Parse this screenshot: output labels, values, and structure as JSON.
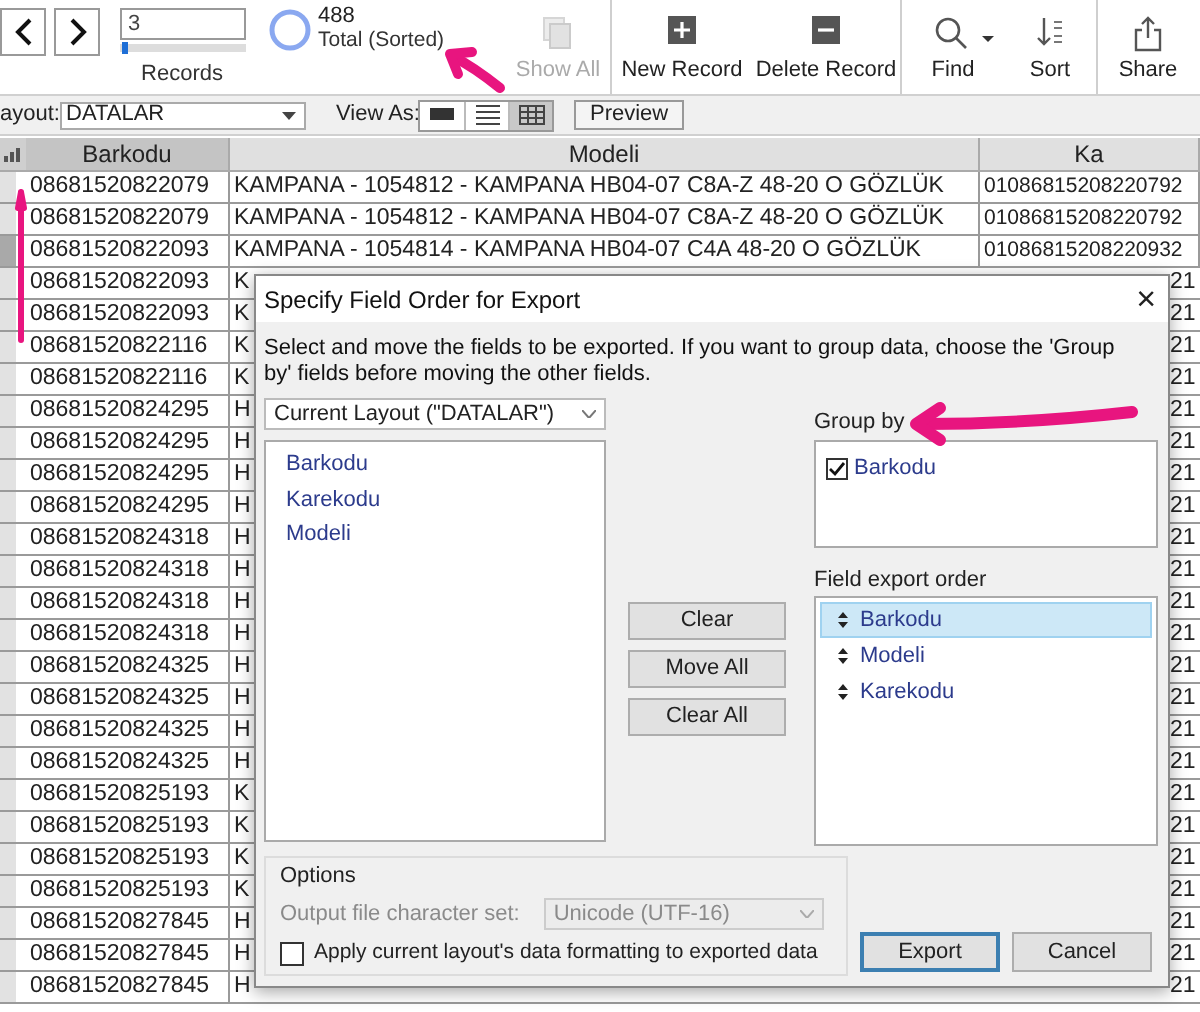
{
  "toolbar": {
    "record_number": "3",
    "record_slider": {
      "level": 0.01
    },
    "records_label": "Records",
    "found_count": "488",
    "found_label": "Total (Sorted)",
    "buttons": [
      {
        "kind": "show_all",
        "label": "Show All",
        "disabled": true
      },
      {
        "kind": "new",
        "label": "New Record",
        "disabled": false
      },
      {
        "kind": "delete",
        "label": "Delete Record",
        "disabled": false
      },
      {
        "kind": "find",
        "label": "Find",
        "disabled": false
      },
      {
        "kind": "sort",
        "label": "Sort",
        "disabled": false
      },
      {
        "kind": "share",
        "label": "Share",
        "disabled": false
      }
    ]
  },
  "layout_bar": {
    "label": "ayout:",
    "layout": "DATALAR",
    "view_as_label": "View As:",
    "view_modes": [
      {
        "kind": "form",
        "selected": false
      },
      {
        "kind": "list",
        "selected": false
      },
      {
        "kind": "table",
        "selected": true
      }
    ],
    "preview": "Preview"
  },
  "table": {
    "columns": [
      {
        "label": "Barkodu",
        "sorted": true
      },
      {
        "label": "Modeli",
        "sorted": false
      },
      {
        "label": "Ka",
        "sorted": false
      }
    ],
    "rows": [
      {
        "selected": false,
        "cells": [
          "08681520822079",
          "KAMPANA - 1054812 - KAMPANA HB04-07 C8A-Z 48-20 O GÖZLÜK",
          "01086815208220792"
        ]
      },
      {
        "selected": false,
        "cells": [
          "08681520822079",
          "KAMPANA - 1054812 - KAMPANA HB04-07 C8A-Z 48-20 O GÖZLÜK",
          "01086815208220792"
        ]
      },
      {
        "selected": true,
        "cells": [
          "08681520822093",
          "KAMPANA - 1054814 - KAMPANA HB04-07 C4A 48-20 O GÖZLÜK",
          "01086815208220932"
        ]
      },
      {
        "selected": false,
        "cells": [
          "08681520822093",
          "K",
          "21"
        ]
      },
      {
        "selected": false,
        "cells": [
          "08681520822093",
          "K",
          "21"
        ]
      },
      {
        "selected": false,
        "cells": [
          "08681520822116",
          "K",
          "21"
        ]
      },
      {
        "selected": false,
        "cells": [
          "08681520822116",
          "K",
          "21"
        ]
      },
      {
        "selected": false,
        "cells": [
          "08681520824295",
          "H",
          "21"
        ]
      },
      {
        "selected": false,
        "cells": [
          "08681520824295",
          "H",
          "21"
        ]
      },
      {
        "selected": false,
        "cells": [
          "08681520824295",
          "H",
          "21"
        ]
      },
      {
        "selected": false,
        "cells": [
          "08681520824295",
          "H",
          "21"
        ]
      },
      {
        "selected": false,
        "cells": [
          "08681520824318",
          "H",
          "21"
        ]
      },
      {
        "selected": false,
        "cells": [
          "08681520824318",
          "H",
          "21"
        ]
      },
      {
        "selected": false,
        "cells": [
          "08681520824318",
          "H",
          "21"
        ]
      },
      {
        "selected": false,
        "cells": [
          "08681520824318",
          "H",
          "21"
        ]
      },
      {
        "selected": false,
        "cells": [
          "08681520824325",
          "H",
          "21"
        ]
      },
      {
        "selected": false,
        "cells": [
          "08681520824325",
          "H",
          "21"
        ]
      },
      {
        "selected": false,
        "cells": [
          "08681520824325",
          "H",
          "21"
        ]
      },
      {
        "selected": false,
        "cells": [
          "08681520824325",
          "H",
          "21"
        ]
      },
      {
        "selected": false,
        "cells": [
          "08681520825193",
          "K",
          "21"
        ]
      },
      {
        "selected": false,
        "cells": [
          "08681520825193",
          "K",
          "21"
        ]
      },
      {
        "selected": false,
        "cells": [
          "08681520825193",
          "K",
          "21"
        ]
      },
      {
        "selected": false,
        "cells": [
          "08681520825193",
          "K",
          "21"
        ]
      },
      {
        "selected": false,
        "cells": [
          "08681520827845",
          "H",
          "21"
        ]
      },
      {
        "selected": false,
        "cells": [
          "08681520827845",
          "H",
          "21"
        ]
      },
      {
        "selected": false,
        "cells": [
          "08681520827845",
          "H",
          "21"
        ]
      }
    ]
  },
  "dialog": {
    "title": "Specify Field Order for Export",
    "close": "×",
    "instructions": "Select and move the fields to be exported. If you want to group data, choose the 'Group by' fields before moving the other fields.",
    "source": "Current Layout (\"DATALAR\")",
    "available_fields": [
      "Barkodu",
      "Karekodu",
      "Modeli"
    ],
    "buttons": [
      "Clear",
      "Move All",
      "Clear All"
    ],
    "group_by_label": "Group by",
    "group_by": [
      {
        "label": "Barkodu",
        "checked": true
      }
    ],
    "export_order_label": "Field export order",
    "export_order": [
      {
        "label": "Barkodu",
        "selected": true
      },
      {
        "label": "Modeli",
        "selected": false
      },
      {
        "label": "Karekodu",
        "selected": false
      }
    ],
    "options_label": "Options",
    "charset_label": "Output file character set:",
    "charset": "Unicode (UTF-16)",
    "apply_formatting": {
      "label": "Apply current layout's data formatting to exported data",
      "checked": false
    },
    "actions": [
      {
        "label": "Export",
        "default": true
      },
      {
        "label": "Cancel",
        "default": false
      }
    ]
  }
}
